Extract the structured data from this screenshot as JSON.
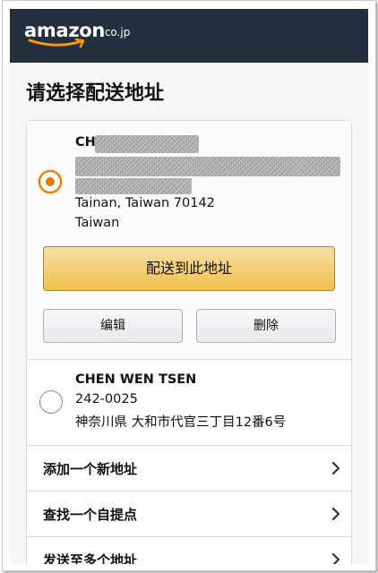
{
  "header": {
    "logo_word": "amazon",
    "logo_suffix": ".co.jp",
    "logo_alt": "amazon.co.jp"
  },
  "page": {
    "title": "请选择配送地址"
  },
  "addresses": [
    {
      "selected": true,
      "name": "CH",
      "lines": [
        "Tainan, Taiwan 70142",
        "Taiwan"
      ],
      "deliver_button": "配送到此地址",
      "edit_button": "编辑",
      "delete_button": "删除"
    },
    {
      "selected": false,
      "name": "CHEN WEN TSEN",
      "lines": [
        "242-0025",
        "神奈川県 大和市代官三丁目12番6号"
      ]
    }
  ],
  "links": [
    {
      "label": "添加一个新地址",
      "icon": "chevron-right-icon"
    },
    {
      "label": "查找一个自提点",
      "icon": "chevron-right-icon"
    },
    {
      "label": "发送至多个地址",
      "icon": "chevron-right-icon"
    }
  ],
  "colors": {
    "header_bg": "#232f3e",
    "radio_accent": "#e77600",
    "logo_smile": "#ff9900",
    "primary_button": "#f0c14b"
  }
}
